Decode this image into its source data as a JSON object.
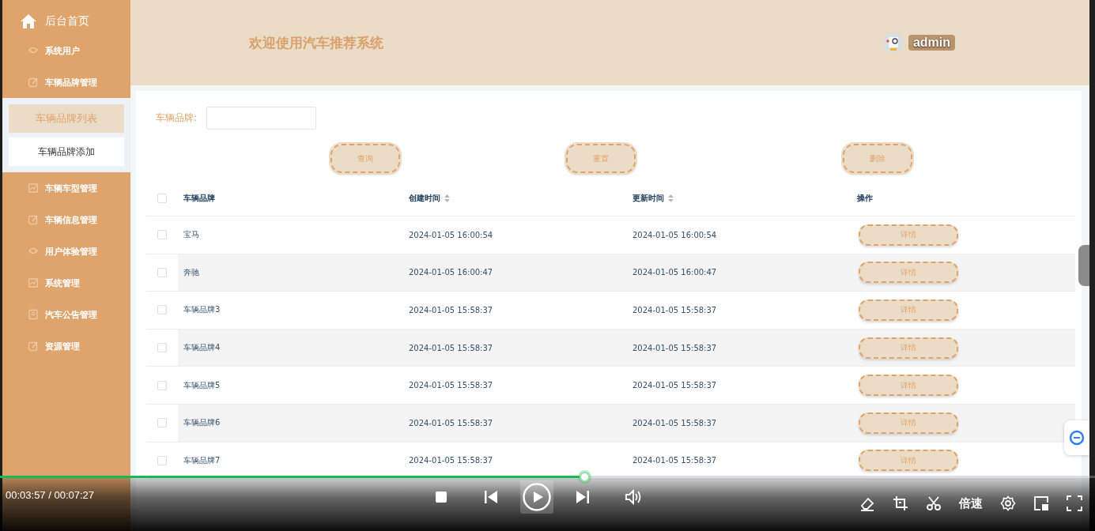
{
  "sidebar": {
    "home": "后台首页",
    "items": [
      {
        "label": "系统用户"
      },
      {
        "label": "车辆品牌管理",
        "children": [
          {
            "label": "车辆品牌列表",
            "selected": true
          },
          {
            "label": "车辆品牌添加",
            "selected": false
          }
        ]
      },
      {
        "label": "车辆车型管理"
      },
      {
        "label": "车辆信息管理"
      },
      {
        "label": "用户体验管理"
      },
      {
        "label": "系统管理"
      },
      {
        "label": "汽车公告管理"
      },
      {
        "label": "资源管理"
      }
    ]
  },
  "header": {
    "title": "欢迎使用汽车推荐系统",
    "user": "admin"
  },
  "filter": {
    "label": "车辆品牌:"
  },
  "buttons": [
    "查询",
    "重置",
    "删除"
  ],
  "table": {
    "select_all": false,
    "columns": [
      {
        "label": "车辆品牌",
        "sortable": false
      },
      {
        "label": "创建时间",
        "sortable": true
      },
      {
        "label": "更新时间",
        "sortable": true
      },
      {
        "label": "操作",
        "sortable": false
      }
    ],
    "rows": [
      {
        "brand": "宝马",
        "created": "2024-01-05 16:00:54",
        "updated": "2024-01-05 16:00:54",
        "action": "详情",
        "checked": false
      },
      {
        "brand": "奔驰",
        "created": "2024-01-05 16:00:47",
        "updated": "2024-01-05 16:00:47",
        "action": "详情",
        "checked": false
      },
      {
        "brand": "车辆品牌3",
        "created": "2024-01-05 15:58:37",
        "updated": "2024-01-05 15:58:37",
        "action": "详情",
        "checked": false
      },
      {
        "brand": "车辆品牌4",
        "created": "2024-01-05 15:58:37",
        "updated": "2024-01-05 15:58:37",
        "action": "详情",
        "checked": false
      },
      {
        "brand": "车辆品牌5",
        "created": "2024-01-05 15:58:37",
        "updated": "2024-01-05 15:58:37",
        "action": "详情",
        "checked": false
      },
      {
        "brand": "车辆品牌6",
        "created": "2024-01-05 15:58:37",
        "updated": "2024-01-05 15:58:37",
        "action": "详情",
        "checked": false
      },
      {
        "brand": "车辆品牌7",
        "created": "2024-01-05 15:58:37",
        "updated": "2024-01-05 15:58:37",
        "action": "详情",
        "checked": false
      }
    ]
  },
  "player": {
    "time": "00:03:57 / 00:07:27",
    "level": 0.529,
    "speed": "倍速"
  }
}
